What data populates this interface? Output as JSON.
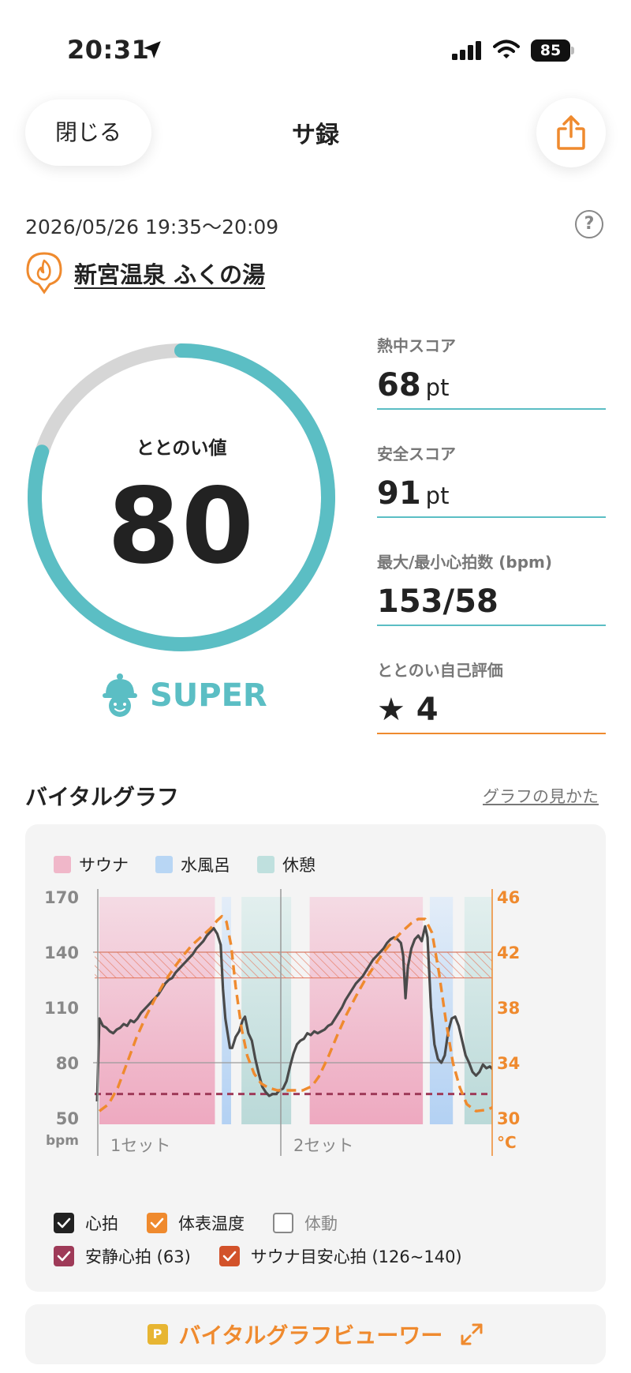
{
  "status_bar": {
    "time": "20:31",
    "battery": "85"
  },
  "header": {
    "close_label": "閉じる",
    "title": "サ録"
  },
  "session": {
    "datetime": "2026/05/26 19:35～20:09",
    "facility": "新宮温泉 ふくの湯"
  },
  "gauge": {
    "label": "ととのい値",
    "value": "80",
    "fraction": 0.8,
    "rank": "SUPER"
  },
  "stats": [
    {
      "label": "熱中スコア",
      "value": "68",
      "unit": "pt"
    },
    {
      "label": "安全スコア",
      "value": "91",
      "unit": "pt"
    },
    {
      "label": "最大/最小心拍数 (bpm)",
      "value": "153/58",
      "unit": ""
    },
    {
      "label": "ととのい自己評価",
      "value": "★ 4",
      "unit": ""
    }
  ],
  "vital": {
    "title": "バイタルグラフ",
    "guide_link": "グラフの見かた",
    "legend": [
      {
        "label": "サウナ",
        "color": "#f0b7c9"
      },
      {
        "label": "水風呂",
        "color": "#b8d6f4"
      },
      {
        "label": "休憩",
        "color": "#bfe0de"
      }
    ],
    "checkboxes": [
      {
        "label": "心拍",
        "checked": true,
        "color": "#222222"
      },
      {
        "label": "体表温度",
        "checked": true,
        "color": "#ef8a2e"
      },
      {
        "label": "体動",
        "checked": false,
        "color": "#888888"
      },
      {
        "label": "安静心拍 (63)",
        "checked": true,
        "color": "#9e3a58"
      },
      {
        "label": "サウナ目安心拍 (126~140)",
        "checked": true,
        "color": "#d2522a"
      }
    ],
    "viewer_label": "バイタルグラフビューワー",
    "viewer_badge": "P"
  },
  "chart_data": {
    "type": "line",
    "left_axis": {
      "unit": "bpm",
      "ticks": [
        "170",
        "140",
        "110",
        "80",
        "50"
      ],
      "range": [
        50,
        170
      ]
    },
    "right_axis": {
      "unit": "°C",
      "ticks": [
        "46",
        "42",
        "38",
        "34",
        "30"
      ],
      "range": [
        30,
        46
      ]
    },
    "set_labels": [
      "1セット",
      "2セット"
    ],
    "x_range": [
      0,
      34
    ],
    "phases": [
      {
        "type": "sauna",
        "x": [
          0,
          10
        ]
      },
      {
        "type": "cold_bath",
        "x": [
          10.6,
          11.4
        ]
      },
      {
        "type": "rest",
        "x": [
          12.3,
          16.6
        ]
      },
      {
        "type": "sauna",
        "x": [
          18.2,
          28
        ]
      },
      {
        "type": "cold_bath",
        "x": [
          28.6,
          30.6
        ]
      },
      {
        "type": "rest",
        "x": [
          31.6,
          36.4
        ]
      }
    ],
    "resting_hr": 63,
    "sauna_target_hr": [
      126,
      140
    ],
    "series": [
      {
        "name": "心拍",
        "points": [
          [
            -0.2,
            59
          ],
          [
            0,
            104
          ],
          [
            0.3,
            100
          ],
          [
            0.6,
            99
          ],
          [
            0.9,
            97
          ],
          [
            1.2,
            96
          ],
          [
            1.5,
            98
          ],
          [
            1.8,
            99
          ],
          [
            2.1,
            101
          ],
          [
            2.4,
            100
          ],
          [
            2.7,
            103
          ],
          [
            3,
            102
          ],
          [
            3.3,
            104
          ],
          [
            3.6,
            107
          ],
          [
            3.9,
            109
          ],
          [
            4.2,
            111
          ],
          [
            4.5,
            113
          ],
          [
            4.8,
            115
          ],
          [
            5.1,
            117
          ],
          [
            5.4,
            120
          ],
          [
            5.7,
            123
          ],
          [
            6,
            125
          ],
          [
            6.3,
            126
          ],
          [
            6.6,
            129
          ],
          [
            6.9,
            131
          ],
          [
            7.2,
            133
          ],
          [
            7.5,
            135
          ],
          [
            7.8,
            137
          ],
          [
            8.1,
            139
          ],
          [
            8.4,
            142
          ],
          [
            8.7,
            144
          ],
          [
            9,
            146
          ],
          [
            9.3,
            149
          ],
          [
            9.6,
            151
          ],
          [
            9.9,
            153
          ],
          [
            10.2,
            150
          ],
          [
            10.5,
            144
          ],
          [
            10.7,
            120
          ],
          [
            10.9,
            104
          ],
          [
            11.1,
            96
          ],
          [
            11.3,
            88
          ],
          [
            11.5,
            88
          ],
          [
            11.8,
            94
          ],
          [
            12.1,
            97
          ],
          [
            12.4,
            103
          ],
          [
            12.6,
            105
          ],
          [
            12.9,
            96
          ],
          [
            13.2,
            92
          ],
          [
            13.5,
            82
          ],
          [
            13.8,
            74
          ],
          [
            14.1,
            67
          ],
          [
            14.4,
            64
          ],
          [
            14.7,
            62
          ],
          [
            15,
            63
          ],
          [
            15.3,
            63
          ],
          [
            15.6,
            65
          ],
          [
            15.9,
            66
          ],
          [
            16.2,
            70
          ],
          [
            16.5,
            78
          ],
          [
            16.8,
            85
          ],
          [
            17.1,
            90
          ],
          [
            17.4,
            92
          ],
          [
            17.7,
            93
          ],
          [
            18,
            96
          ],
          [
            18.3,
            95
          ],
          [
            18.6,
            97
          ],
          [
            18.9,
            96
          ],
          [
            19.2,
            97
          ],
          [
            19.5,
            98
          ],
          [
            19.8,
            100
          ],
          [
            20.1,
            101
          ],
          [
            20.4,
            104
          ],
          [
            20.7,
            107
          ],
          [
            21,
            110
          ],
          [
            21.3,
            114
          ],
          [
            21.6,
            117
          ],
          [
            21.9,
            120
          ],
          [
            22.2,
            123
          ],
          [
            22.5,
            125
          ],
          [
            22.8,
            127
          ],
          [
            23.1,
            130
          ],
          [
            23.4,
            133
          ],
          [
            23.7,
            136
          ],
          [
            24,
            138
          ],
          [
            24.3,
            140
          ],
          [
            24.6,
            142
          ],
          [
            24.9,
            145
          ],
          [
            25.2,
            147
          ],
          [
            25.5,
            148
          ],
          [
            25.8,
            147
          ],
          [
            26.1,
            145
          ],
          [
            26.3,
            138
          ],
          [
            26.5,
            115
          ],
          [
            26.7,
            132
          ],
          [
            27,
            142
          ],
          [
            27.3,
            147
          ],
          [
            27.6,
            149
          ],
          [
            27.9,
            146
          ],
          [
            28.2,
            154
          ],
          [
            28.4,
            148
          ],
          [
            28.7,
            110
          ],
          [
            29,
            90
          ],
          [
            29.3,
            82
          ],
          [
            29.6,
            80
          ],
          [
            29.9,
            84
          ],
          [
            30.2,
            97
          ],
          [
            30.5,
            104
          ],
          [
            30.8,
            105
          ],
          [
            31.1,
            100
          ],
          [
            31.4,
            92
          ],
          [
            31.7,
            84
          ],
          [
            32,
            80
          ],
          [
            32.3,
            75
          ],
          [
            32.6,
            73
          ],
          [
            32.9,
            75
          ],
          [
            33.2,
            79
          ],
          [
            33.5,
            77
          ],
          [
            33.8,
            78
          ],
          [
            34.1,
            76
          ],
          [
            34.4,
            77
          ],
          [
            34.7,
            75
          ],
          [
            35,
            79
          ],
          [
            35.3,
            85
          ],
          [
            35.6,
            90
          ],
          [
            36,
            88
          ]
        ]
      },
      {
        "name": "体表温度",
        "points": [
          [
            0,
            30.5
          ],
          [
            0.8,
            31
          ],
          [
            1.6,
            32.2
          ],
          [
            2.4,
            34
          ],
          [
            3.2,
            35.8
          ],
          [
            4,
            37.3
          ],
          [
            4.8,
            38.6
          ],
          [
            5.6,
            39.8
          ],
          [
            6.4,
            40.8
          ],
          [
            7.2,
            41.7
          ],
          [
            8,
            42.5
          ],
          [
            8.8,
            43.1
          ],
          [
            9.6,
            43.7
          ],
          [
            10.2,
            44.3
          ],
          [
            10.6,
            44.6
          ],
          [
            11,
            44.2
          ],
          [
            11.4,
            42.5
          ],
          [
            11.8,
            39.5
          ],
          [
            12.3,
            36.5
          ],
          [
            12.8,
            34.5
          ],
          [
            13.4,
            33.2
          ],
          [
            14,
            32.5
          ],
          [
            14.6,
            32.2
          ],
          [
            15.4,
            32
          ],
          [
            16.6,
            32
          ],
          [
            17.6,
            32
          ],
          [
            18.4,
            32.3
          ],
          [
            19,
            33
          ],
          [
            19.8,
            34.4
          ],
          [
            20.6,
            36
          ],
          [
            21.4,
            37.5
          ],
          [
            22.2,
            38.8
          ],
          [
            23,
            40
          ],
          [
            23.8,
            41
          ],
          [
            24.6,
            42
          ],
          [
            25.4,
            42.8
          ],
          [
            26.2,
            43.5
          ],
          [
            27,
            44.1
          ],
          [
            27.6,
            44.4
          ],
          [
            28.2,
            44.4
          ],
          [
            28.8,
            43.4
          ],
          [
            29.4,
            40.5
          ],
          [
            30,
            37
          ],
          [
            30.6,
            34
          ],
          [
            31.2,
            32.2
          ],
          [
            31.8,
            31
          ],
          [
            32.6,
            30.5
          ],
          [
            33.6,
            30.6
          ],
          [
            34.6,
            31
          ],
          [
            35.6,
            31.4
          ],
          [
            36.4,
            31.6
          ]
        ]
      }
    ]
  }
}
